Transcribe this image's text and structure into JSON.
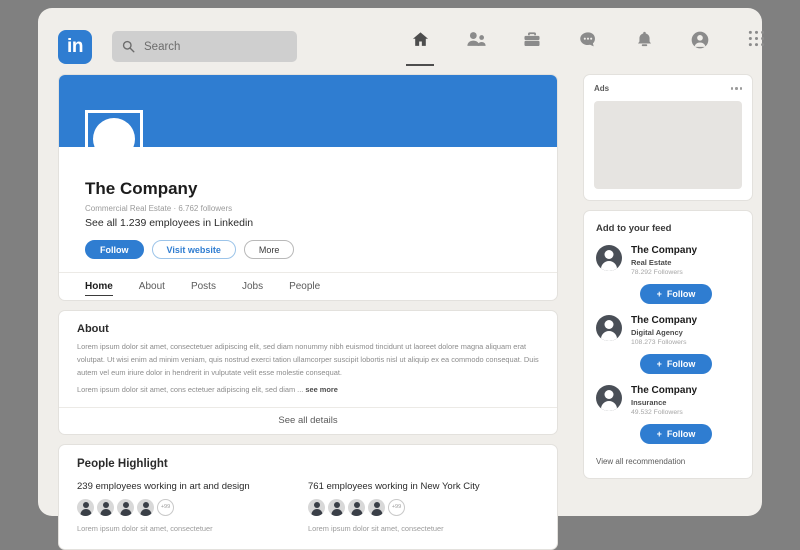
{
  "header": {
    "logo_text": "in",
    "search_placeholder": "Search",
    "nav": [
      {
        "name": "home",
        "label": "Home",
        "active": true
      },
      {
        "name": "network",
        "label": "My Network",
        "active": false
      },
      {
        "name": "jobs",
        "label": "Jobs",
        "active": false
      },
      {
        "name": "messaging",
        "label": "Messaging",
        "active": false
      },
      {
        "name": "notifications",
        "label": "Notifications",
        "active": false
      },
      {
        "name": "profile",
        "label": "Me",
        "active": false
      },
      {
        "name": "apps",
        "label": "Work",
        "active": false
      }
    ]
  },
  "profile": {
    "name": "The Company",
    "subtitle": "Commercial Real Estate · 6.762 followers",
    "employees_link": "See all 1.239 employees in Linkedin",
    "buttons": {
      "follow": "Follow",
      "website": "Visit website",
      "more": "More"
    },
    "tabs": [
      {
        "label": "Home",
        "active": true
      },
      {
        "label": "About",
        "active": false
      },
      {
        "label": "Posts",
        "active": false
      },
      {
        "label": "Jobs",
        "active": false
      },
      {
        "label": "People",
        "active": false
      }
    ]
  },
  "about": {
    "title": "About",
    "paragraph": "Lorem ipsum dolor sit amet, consectetuer adipiscing elit, sed diam nonummy nibh euismod tincidunt ut laoreet dolore magna aliquam erat volutpat. Ut wisi enim ad minim veniam, quis nostrud exerci tation ullamcorper suscipit lobortis nisl ut aliquip ex ea commodo consequat. Duis autem vel eum iriure dolor in hendrerit in vulputate velit esse molestie consequat.",
    "truncated": "Lorem ipsum dolor sit amet, cons ectetuer adipiscing elit, sed diam ...",
    "see_more": "see more",
    "see_all_details": "See all details"
  },
  "people_highlight": {
    "title": "People Highlight",
    "columns": [
      {
        "heading": "239 employees working in art and design",
        "avatar_count": 4,
        "overflow_badge": "+99",
        "note": "Lorem ipsum dolor sit amet, consectetuer"
      },
      {
        "heading": "761 employees working in New York City",
        "avatar_count": 4,
        "overflow_badge": "+99",
        "note": "Lorem ipsum dolor sit amet, consectetuer"
      }
    ]
  },
  "ads": {
    "title": "Ads",
    "menu": "more-options"
  },
  "feed": {
    "title": "Add to your feed",
    "items": [
      {
        "name": "The Company",
        "role": "Real Estate",
        "followers": "78.292 Followers",
        "follow_label": "Follow"
      },
      {
        "name": "The Company",
        "role": "Digital Agency",
        "followers": "108.273 Followers",
        "follow_label": "Follow"
      },
      {
        "name": "The Company",
        "role": "Insurance",
        "followers": "49.532 Followers",
        "follow_label": "Follow"
      }
    ],
    "view_all": "View all recommendation"
  },
  "colors": {
    "brand_blue": "#2f7dd1",
    "page_bg": "#f0eeea",
    "outer_bg": "#808080"
  }
}
